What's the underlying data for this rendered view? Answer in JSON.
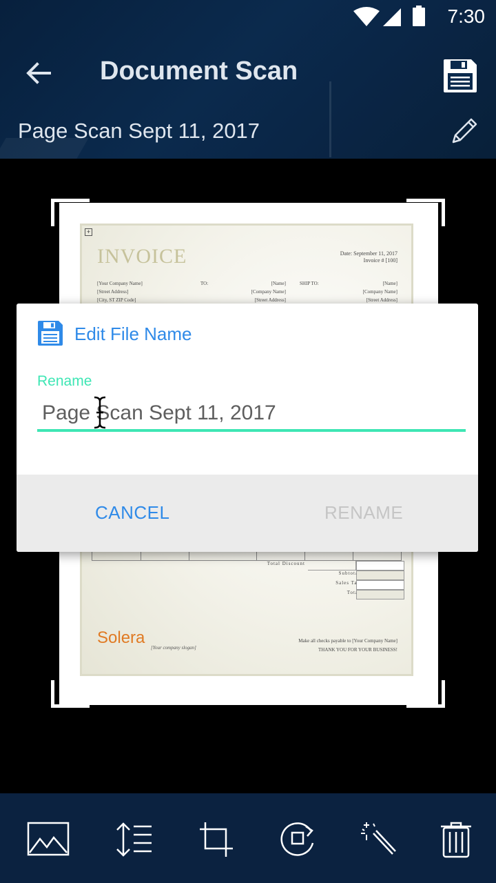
{
  "status": {
    "time": "7:30"
  },
  "header": {
    "title": "Document Scan",
    "document_name": "Page Scan Sept 11, 2017"
  },
  "preview": {
    "invoice_title": "INVOICE",
    "invoice_date_line": "Date: September 11, 2017",
    "invoice_number_line": "Invoice # [100]",
    "company_block": [
      "[Your Company Name]",
      "[Street Address]",
      "[City, ST  ZIP Code]"
    ],
    "to_label": "TO:",
    "to_block": [
      "[Name]",
      "[Company Name]",
      "[Street Address]"
    ],
    "ship_to_label": "SHIP TO:",
    "ship_block": [
      "[Name]",
      "[Company Name]",
      "[Street Address]"
    ],
    "totals_labels": [
      "Total Discount",
      "Subtotal",
      "Sales Tax",
      "Total"
    ],
    "logo_text": "Solera",
    "slogan": "[Your company slogan]",
    "footer_line1": "Make all checks payable to [Your Company Name]",
    "footer_line2": "THANK YOU FOR YOUR BUSINESS!"
  },
  "dialog": {
    "title": "Edit File Name",
    "field_label": "Rename",
    "field_value": "Page Scan Sept 11, 2017",
    "cancel_label": "CANCEL",
    "rename_label": "RENAME"
  },
  "colors": {
    "accent_blue": "#2f8ae8",
    "accent_teal": "#3ee6b4",
    "header_bg": "#0b2a4d",
    "toolbar_bg": "#0b2240"
  },
  "toolbar": {
    "icons": [
      "image-icon",
      "line-spacing-icon",
      "crop-icon",
      "rotate-icon",
      "magic-wand-icon",
      "trash-icon"
    ]
  }
}
